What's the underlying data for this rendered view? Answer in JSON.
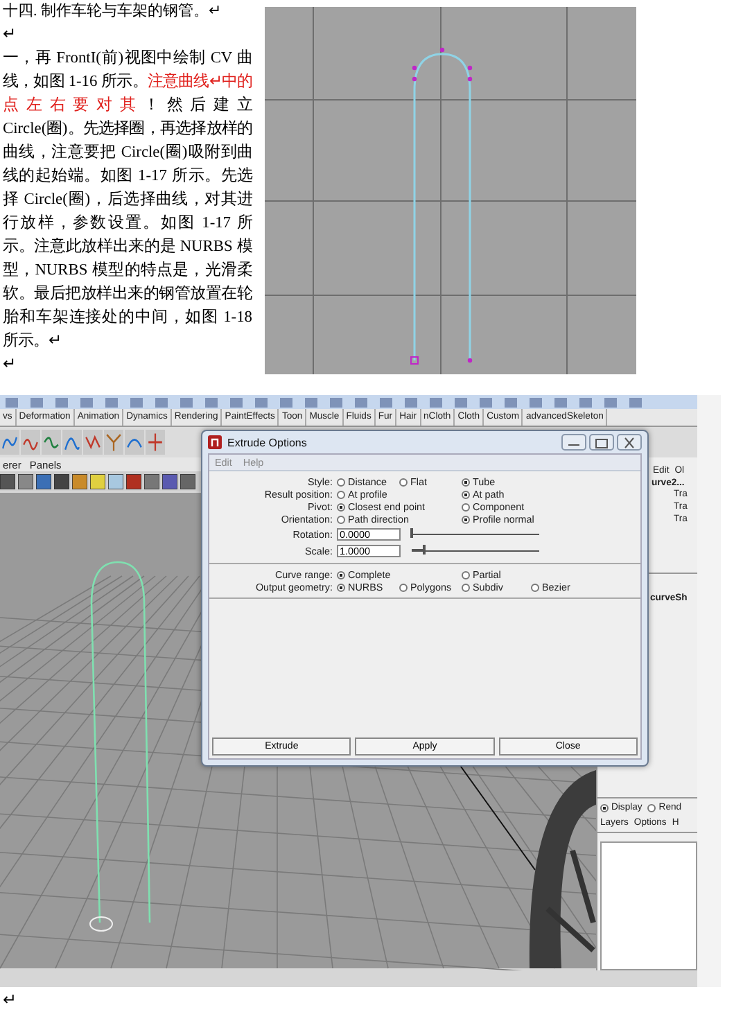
{
  "document": {
    "blocks": [
      {
        "kind": "heading",
        "text": "十四. 制作车轮与车架的钢管。↵"
      },
      {
        "kind": "mark",
        "text": "↵"
      },
      {
        "kind": "paragraph",
        "segments": [
          {
            "text": "一，再 FrontI(前)视图中绘制 CV 曲线，如图 1-16 所示。",
            "emphasis": false
          },
          {
            "text": "注意曲线↵中的点左右要对其",
            "emphasis": true
          },
          {
            "text": "！然后建立 Circle(圈)。先选择圈，再选择放样的曲线，注意要把 Circle(圈)吸附到曲线的起始端。如图 1-17 所示。先选择 Circle(圈)，后选择曲线，对其进行放样，参数设置。如图 1-17 所示。注意此放样出来的是 NURBS 模型，NURBS 模型的特点是，光滑柔软。最后把放样出来的钢管放置在轮胎和车架连接处的中间，如图 1-18 所示。↵",
            "emphasis": false
          }
        ]
      },
      {
        "kind": "mark",
        "text": "↵"
      }
    ],
    "end_mark": "↵"
  },
  "maya_window": {
    "shelf_tabs": [
      "vs",
      "Deformation",
      "Animation",
      "Dynamics",
      "Rendering",
      "PaintEffects",
      "Toon",
      "Muscle",
      "Fluids",
      "Fur",
      "Hair",
      "nCloth",
      "Cloth",
      "Custom",
      "advancedSkeleton"
    ],
    "panel_menu": [
      "erer",
      "Panels"
    ],
    "channel_box": {
      "menu": [
        "Edit",
        "Ol"
      ],
      "node": "urve2...",
      "attributes": [
        "Tra",
        "Tra",
        "Tra"
      ],
      "shape_node": "curveSh",
      "layer_modes": [
        {
          "label": "Display",
          "selected": true
        },
        {
          "label": "Rend",
          "selected": false
        }
      ],
      "layer_menu": [
        "Layers",
        "Options",
        "H"
      ]
    },
    "dialog": {
      "title": "Extrude Options",
      "menu": [
        "Edit",
        "Help"
      ],
      "option_groups": [
        {
          "rows": [
            {
              "kind": "radios",
              "label": "Style:",
              "options": [
                {
                  "label": "Distance",
                  "selected": false
                },
                {
                  "label": "Flat",
                  "selected": false
                },
                {
                  "label": "Tube",
                  "selected": true
                }
              ]
            },
            {
              "kind": "radios",
              "label": "Result position:",
              "options": [
                {
                  "label": "At profile",
                  "selected": false
                },
                {
                  "label": "At path",
                  "selected": true
                }
              ]
            },
            {
              "kind": "radios",
              "label": "Pivot:",
              "options": [
                {
                  "label": "Closest end point",
                  "selected": true
                },
                {
                  "label": "Component",
                  "selected": false
                }
              ]
            },
            {
              "kind": "radios",
              "label": "Orientation:",
              "options": [
                {
                  "label": "Path direction",
                  "selected": false
                },
                {
                  "label": "Profile normal",
                  "selected": true
                }
              ]
            },
            {
              "kind": "slider",
              "label": "Rotation:",
              "value": "0.0000",
              "level": 0.0
            },
            {
              "kind": "slider",
              "label": "Scale:",
              "value": "1.0000",
              "level": 0.1
            }
          ]
        },
        {
          "rows": [
            {
              "kind": "radios",
              "label": "Curve range:",
              "options": [
                {
                  "label": "Complete",
                  "selected": true
                },
                {
                  "label": "Partial",
                  "selected": false
                }
              ]
            },
            {
              "kind": "radios",
              "label": "Output geometry:",
              "options": [
                {
                  "label": "NURBS",
                  "selected": true
                },
                {
                  "label": "Polygons",
                  "selected": false
                },
                {
                  "label": "Subdiv",
                  "selected": false
                },
                {
                  "label": "Bezier",
                  "selected": false
                }
              ]
            }
          ]
        }
      ],
      "buttons": [
        "Extrude",
        "Apply",
        "Close"
      ]
    }
  }
}
